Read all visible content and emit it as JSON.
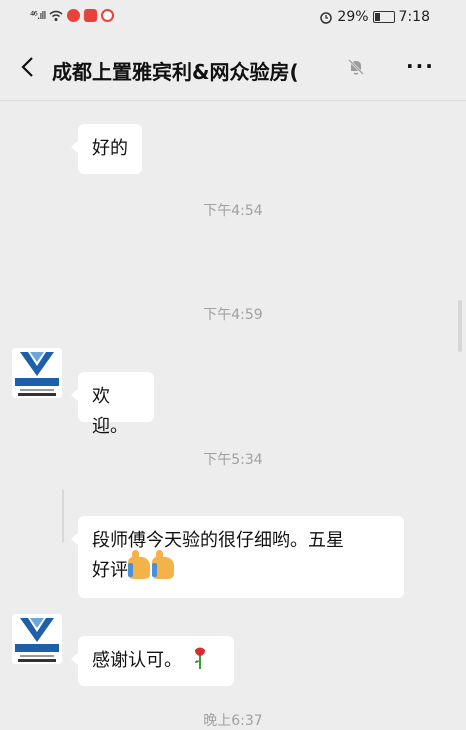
{
  "status_bar": {
    "signal": "⁴⁶.ıll",
    "battery_percent": "29%",
    "time": "7:18"
  },
  "header": {
    "title": "成都上置雅宾利&网众验房(",
    "back_icon": "chevron-left-icon",
    "mute_icon": "bell-muted-icon",
    "more_label": "···"
  },
  "messages": [
    {
      "type": "text",
      "text": "好的"
    },
    {
      "type": "time",
      "text": "下午4:54"
    },
    {
      "type": "time",
      "text": "下午4:59"
    },
    {
      "type": "text",
      "sender": "网众验房",
      "text": "欢迎。"
    },
    {
      "type": "time",
      "text": "下午5:34"
    },
    {
      "type": "text",
      "line1": "段师傅今天验的很仔细哟。五星",
      "line2": "好评"
    },
    {
      "type": "text",
      "sender": "网众验房",
      "text": "感谢认可。"
    },
    {
      "type": "time",
      "text": "晚上6:37"
    }
  ],
  "avatar": {
    "brand": "网众验房",
    "phone": "400-028-5996"
  },
  "colors": {
    "background": "#ededed",
    "bubble": "#ffffff",
    "timestamp": "#a0a0a0",
    "avatar_blue": "#1d5fa8"
  }
}
